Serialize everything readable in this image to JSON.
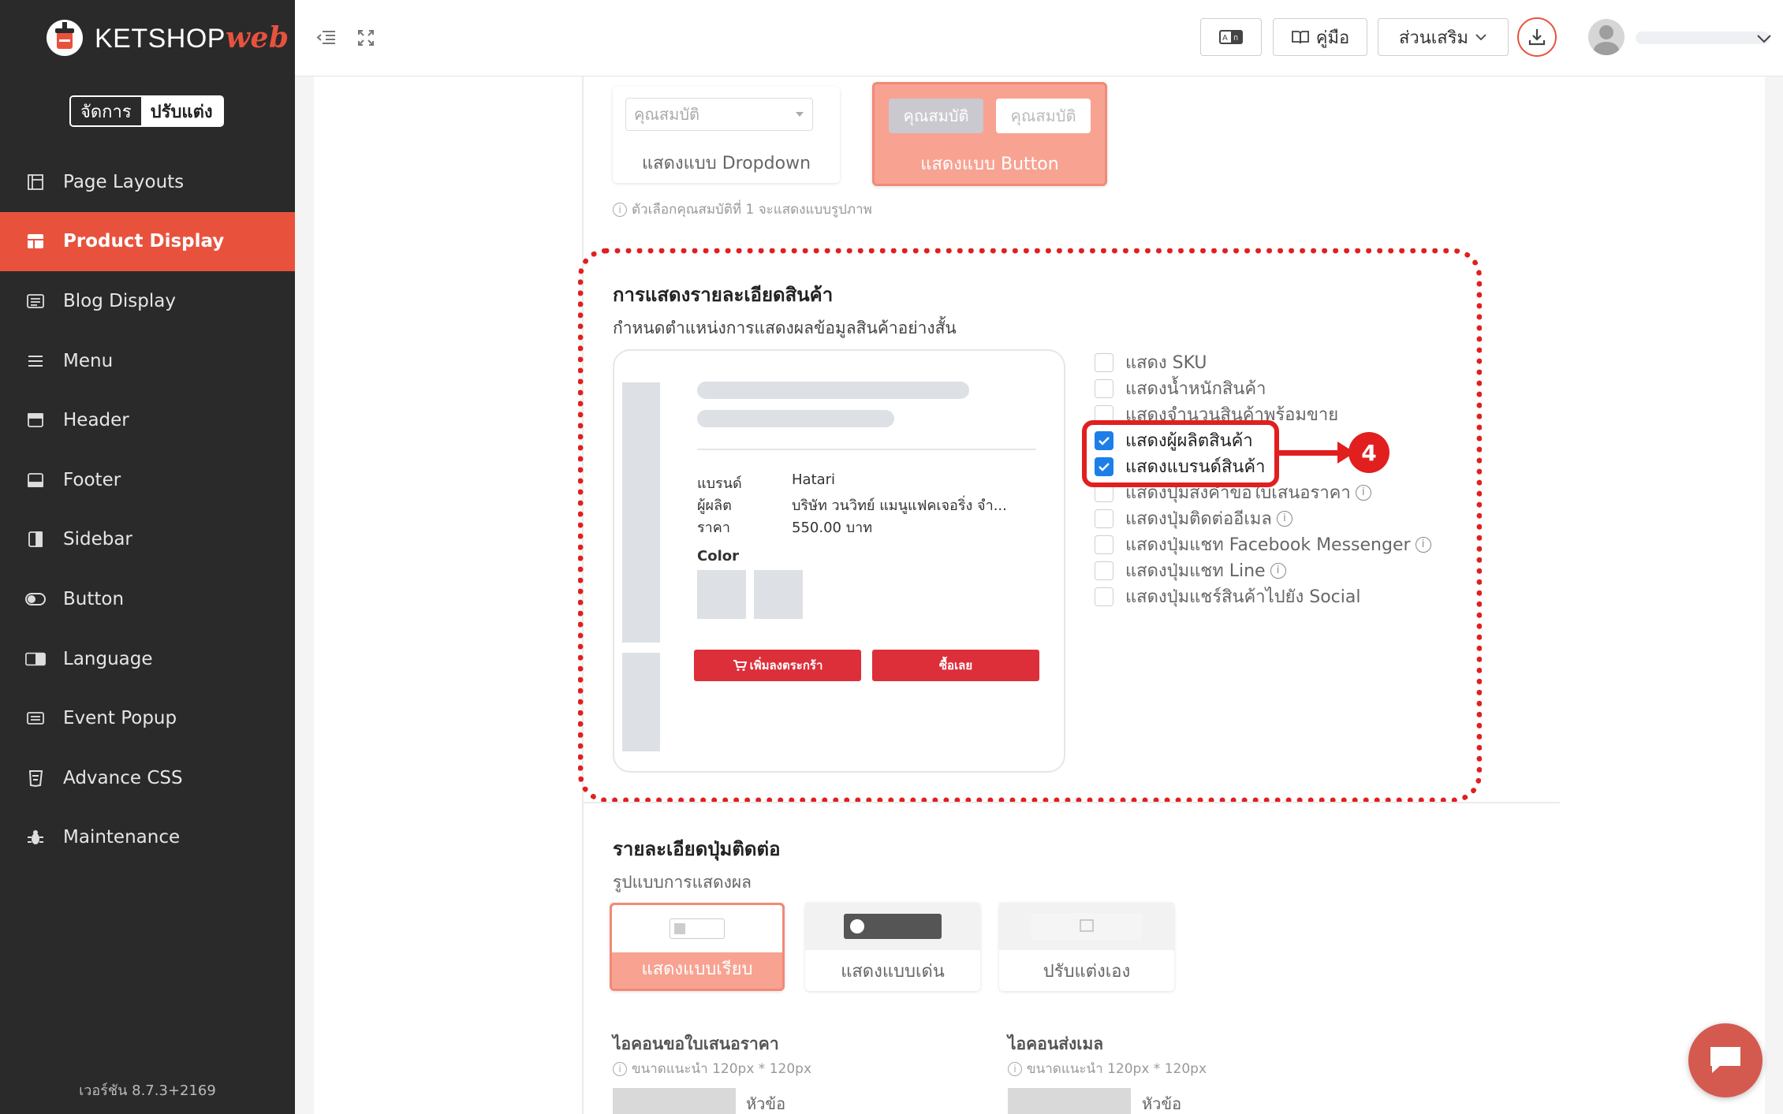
{
  "brand": {
    "name": "KETSHOP",
    "suffix": "web"
  },
  "mode_toggle": {
    "manage": "จัดการ",
    "customize": "ปรับแต่ง"
  },
  "sidebar": {
    "items": [
      {
        "label": "Page Layouts",
        "icon": "layout-icon"
      },
      {
        "label": "Product Display",
        "icon": "grid-icon",
        "active": true
      },
      {
        "label": "Blog Display",
        "icon": "blog-icon"
      },
      {
        "label": "Menu",
        "icon": "menu-icon"
      },
      {
        "label": "Header",
        "icon": "header-icon"
      },
      {
        "label": "Footer",
        "icon": "footer-icon"
      },
      {
        "label": "Sidebar",
        "icon": "sidebar-icon"
      },
      {
        "label": "Button",
        "icon": "toggle-icon"
      },
      {
        "label": "Language",
        "icon": "language-icon"
      },
      {
        "label": "Event Popup",
        "icon": "popup-icon"
      },
      {
        "label": "Advance CSS",
        "icon": "css-icon"
      },
      {
        "label": "Maintenance",
        "icon": "bug-icon"
      }
    ],
    "version": "เวอร์ชัน 8.7.3+2169"
  },
  "topbar": {
    "manual_label": "คู่มือ",
    "addons_label": "ส่วนเสริม"
  },
  "attribute_display": {
    "select_placeholder": "คุณสมบัติ",
    "btn_sample_1": "คุณสมบัติ",
    "btn_sample_2": "คุณสมบัติ",
    "dropdown_caption": "แสดงแบบ Dropdown",
    "button_caption": "แสดงแบบ Button",
    "hint": "ตัวเลือกคุณสมบัติที่ 1 จะแสดงแบบรูปภาพ"
  },
  "product_detail": {
    "title": "การแสดงรายละเอียดสินค้า",
    "subtitle": "กำหนดตำแหน่งการแสดงผลข้อมูลสินค้าอย่างสั้น",
    "preview": {
      "brand_label": "แบรนด์",
      "brand_value": "Hatari",
      "maker_label": "ผู้ผลิต",
      "maker_value": "บริษัท วนวิทย์ แมนูแฟคเจอริ่ง จำ...",
      "price_label": "ราคา",
      "price_value": "550.00 บาท",
      "color_label": "Color",
      "add_to_cart": "เพิ่มลงตระกร้า",
      "buy_now": "ซื้อเลย"
    },
    "options": [
      {
        "label": "แสดง SKU",
        "checked": false,
        "info": false
      },
      {
        "label": "แสดงน้ำหนักสินค้า",
        "checked": false,
        "info": false
      },
      {
        "label": "แสดงจำนวนสินค้าพร้อมขาย",
        "checked": false,
        "info": false
      },
      {
        "label": "แสดงผู้ผลิตสินค้า",
        "checked": true,
        "info": false
      },
      {
        "label": "แสดงแบรนด์สินค้า",
        "checked": true,
        "info": false
      },
      {
        "label": "แสดงปุ่มส่งคำขอใบเสนอราคา",
        "checked": false,
        "info": true
      },
      {
        "label": "แสดงปุ่มติดต่ออีเมล",
        "checked": false,
        "info": true
      },
      {
        "label": "แสดงปุ่มแชท Facebook Messenger",
        "checked": false,
        "info": true
      },
      {
        "label": "แสดงปุ่มแชท Line",
        "checked": false,
        "info": true
      },
      {
        "label": "แสดงปุ่มแชร์สินค้าไปยัง Social",
        "checked": false,
        "info": false
      }
    ],
    "step_badge": "4"
  },
  "contact_buttons": {
    "title": "รายละเอียดปุ่มติดต่อ",
    "subtitle": "รูปแบบการแสดงผล",
    "styles": [
      {
        "label": "แสดงแบบเรียบ",
        "selected": true
      },
      {
        "label": "แสดงแบบเด่น",
        "selected": false
      },
      {
        "label": "ปรับแต่งเอง",
        "selected": false
      }
    ],
    "quote_icon_title": "ไอคอนขอใบเสนอราคา",
    "quote_icon_hint": "ขนาดแนะนำ 120px * 120px",
    "quote_icon_caption": "หัวข้อ",
    "mail_icon_title": "ไอคอนส่งเมล",
    "mail_icon_hint": "ขนาดแนะนำ 120px * 120px",
    "mail_icon_caption": "หัวข้อ"
  },
  "colors": {
    "accent": "#e8523d",
    "sidebar_bg": "#2a2a2a",
    "highlight": "#e11f1f",
    "checkbox": "#1c7ee8"
  }
}
